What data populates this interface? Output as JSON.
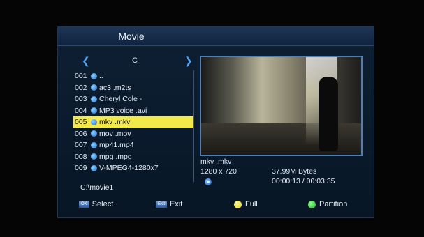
{
  "title": "Movie",
  "nav": {
    "current": "C"
  },
  "files": [
    {
      "num": "001",
      "name": ".."
    },
    {
      "num": "002",
      "name": "ac3 .m2ts"
    },
    {
      "num": "003",
      "name": "Cheryl Cole -"
    },
    {
      "num": "004",
      "name": "MP3 voice .avi"
    },
    {
      "num": "005",
      "name": "mkv .mkv",
      "selected": true
    },
    {
      "num": "006",
      "name": "mov .mov"
    },
    {
      "num": "007",
      "name": "mp41.mp4"
    },
    {
      "num": "008",
      "name": "mpg .mpg"
    },
    {
      "num": "009",
      "name": "V-MPEG4-1280x7"
    }
  ],
  "path": "C:\\movie1",
  "info": {
    "filename": "mkv .mkv",
    "resolution": "1280 x 720",
    "size": "37.99M Bytes",
    "time": "00:00:13 / 00:03:35"
  },
  "footer": {
    "select_key": "OK",
    "select_label": "Select",
    "exit_key": "Exit",
    "exit_label": "Exit",
    "full_label": "Full",
    "partition_label": "Partition"
  },
  "colors": {
    "highlight": "#f2e94a",
    "accent": "#4aa3f5",
    "yellow": "#e3d41a",
    "green": "#18b02a"
  }
}
